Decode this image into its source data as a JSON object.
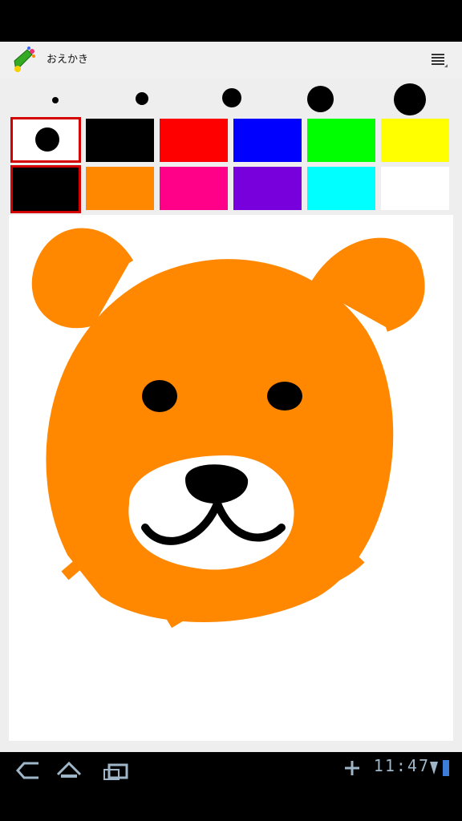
{
  "app": {
    "title": "おえかき",
    "icon": "app-pencil-icon"
  },
  "menu": {
    "icon": "overflow-menu-icon"
  },
  "brush_sizes": [
    {
      "name": "brush-size-1",
      "size": 1
    },
    {
      "name": "brush-size-2",
      "size": 2
    },
    {
      "name": "brush-size-3",
      "size": 3
    },
    {
      "name": "brush-size-4",
      "size": 4
    },
    {
      "name": "brush-size-5",
      "size": 5
    }
  ],
  "colors": {
    "row1": [
      "#ffffff",
      "#000000",
      "#ff0000",
      "#0000ff",
      "#00ff00",
      "#ffff00"
    ],
    "row2": [
      "#000000",
      "#ff8800",
      "#ff0088",
      "#7700dd",
      "#00ffff",
      "#ffffff"
    ],
    "selected_brush_preview": "#000000",
    "accent_selected": "#d40000",
    "drawing_main": "#ff8800"
  },
  "status": {
    "time": "11:47"
  },
  "nav": {
    "back": "back-icon",
    "home": "home-icon",
    "recent": "recent-apps-icon"
  }
}
